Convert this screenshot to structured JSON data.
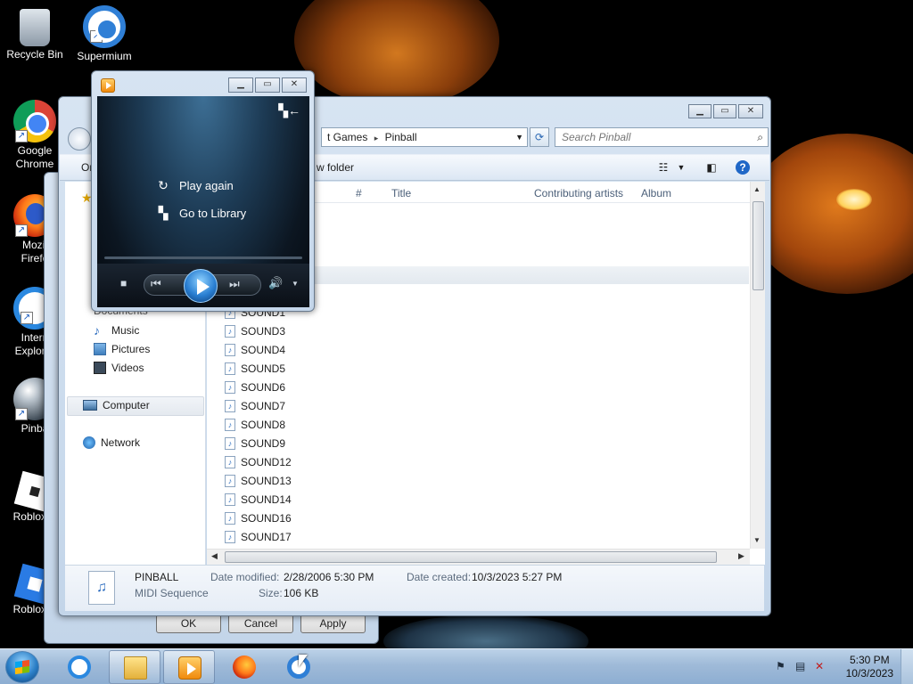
{
  "desktop": {
    "icons": [
      {
        "label": "Recycle Bin",
        "icon": "recycle-bin-icon"
      },
      {
        "label": "Supermium",
        "icon": "supermium-icon"
      },
      {
        "label": "Google\nChrome",
        "icon": "chrome-icon"
      },
      {
        "label": "Mozil\nFirefo",
        "icon": "firefox-icon"
      },
      {
        "label": "Intern\nExplorer",
        "icon": "internet-explorer-icon"
      },
      {
        "label": "Pinba",
        "icon": "pinball-icon"
      },
      {
        "label": "Roblox P",
        "icon": "roblox-player-icon"
      },
      {
        "label": "Roblox S",
        "icon": "roblox-studio-icon"
      }
    ]
  },
  "explorer": {
    "address": {
      "crumb_prev": "t Games",
      "crumb_current": "Pinball"
    },
    "search": {
      "placeholder": "Search Pinball"
    },
    "toolbar": {
      "organize": "Or",
      "new_folder": "w folder"
    },
    "columns": [
      "#",
      "Title",
      "Contributing artists",
      "Album"
    ],
    "nav": {
      "documents": "Documents",
      "music": "Music",
      "pictures": "Pictures",
      "videos": "Videos",
      "computer": "Computer",
      "network": "Network"
    },
    "files": [
      "SOUND1",
      "SOUND3",
      "SOUND4",
      "SOUND5",
      "SOUND6",
      "SOUND7",
      "SOUND8",
      "SOUND9",
      "SOUND12",
      "SOUND13",
      "SOUND14",
      "SOUND16",
      "SOUND17"
    ],
    "details": {
      "name": "PINBALL",
      "type": "MIDI Sequence",
      "modified_label": "Date modified:",
      "modified_value": "2/28/2006 5:30 PM",
      "created_label": "Date created:",
      "created_value": "10/3/2023 5:27 PM",
      "size_label": "Size:",
      "size_value": "106 KB"
    }
  },
  "properties": {
    "ok": "OK",
    "cancel": "Cancel",
    "apply": "Apply"
  },
  "player": {
    "play_again": "Play again",
    "go_to_library": "Go to Library"
  },
  "taskbar": {
    "time": "5:30 PM",
    "date": "10/3/2023"
  }
}
